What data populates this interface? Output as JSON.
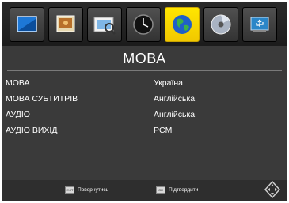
{
  "tabs": [
    {
      "icon": "picture-icon"
    },
    {
      "icon": "image-settings-icon"
    },
    {
      "icon": "tv-search-icon"
    },
    {
      "icon": "clock-icon"
    },
    {
      "icon": "globe-icon",
      "active": true
    },
    {
      "icon": "disc-icon"
    },
    {
      "icon": "usb-icon"
    }
  ],
  "title": "МОВА",
  "rows": [
    {
      "label": "МОВА",
      "value": "Україна"
    },
    {
      "label": "МОВА СУБТИТРІВ",
      "value": "Англійська"
    },
    {
      "label": "АУДІО",
      "value": "Англійська"
    },
    {
      "label": "АУДІО ВИХІД",
      "value": "PCM"
    }
  ],
  "hints": {
    "back": {
      "key": "EXIT",
      "label": "Повернутись"
    },
    "ok": {
      "key": "OK",
      "label": "Підтвердити"
    }
  },
  "colors": {
    "active_tab": "#f5d600",
    "background": "#3a3a3a"
  }
}
